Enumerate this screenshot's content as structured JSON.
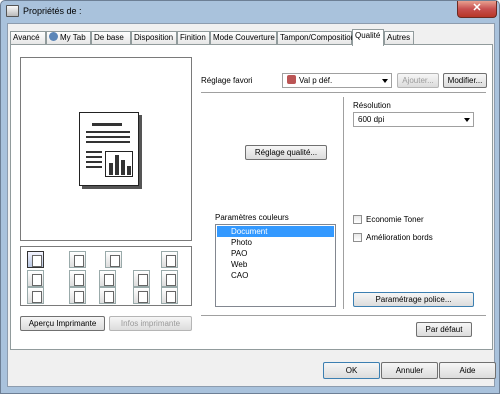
{
  "window": {
    "title": "Propriétés de :",
    "close_glyph": "✕"
  },
  "tabs": [
    {
      "label": "Avancé"
    },
    {
      "label": "My Tab"
    },
    {
      "label": "De base"
    },
    {
      "label": "Disposition"
    },
    {
      "label": "Finition"
    },
    {
      "label": "Mode Couverture"
    },
    {
      "label": "Tampon/Composition"
    },
    {
      "label": "Qualité"
    },
    {
      "label": "Autres"
    }
  ],
  "active_tab": "Qualité",
  "favorite": {
    "label": "Réglage favori",
    "value": "Val p déf.",
    "add_label": "Ajouter...",
    "modify_label": "Modifier..."
  },
  "resolution": {
    "label": "Résolution",
    "value": "600 dpi"
  },
  "quality_settings_button": "Réglage qualité...",
  "color_params": {
    "label": "Paramètres couleurs",
    "items": [
      "Document",
      "Photo",
      "PAO",
      "Web",
      "CAO"
    ],
    "selected": "Document"
  },
  "economy_toner": {
    "label": "Economie Toner",
    "checked": false
  },
  "edge_enhance": {
    "label": "Amélioration bords",
    "checked": false
  },
  "font_settings_button": "Paramétrage police...",
  "default_button": "Par défaut",
  "preview_button": "Aperçu Imprimante",
  "printer_info_button": "Infos imprimante",
  "dialog_buttons": {
    "ok": "OK",
    "cancel": "Annuler",
    "help": "Aide"
  },
  "colors": {
    "selection": "#3399ff",
    "title_bar": "#a9c2dc",
    "close": "#c75050"
  }
}
